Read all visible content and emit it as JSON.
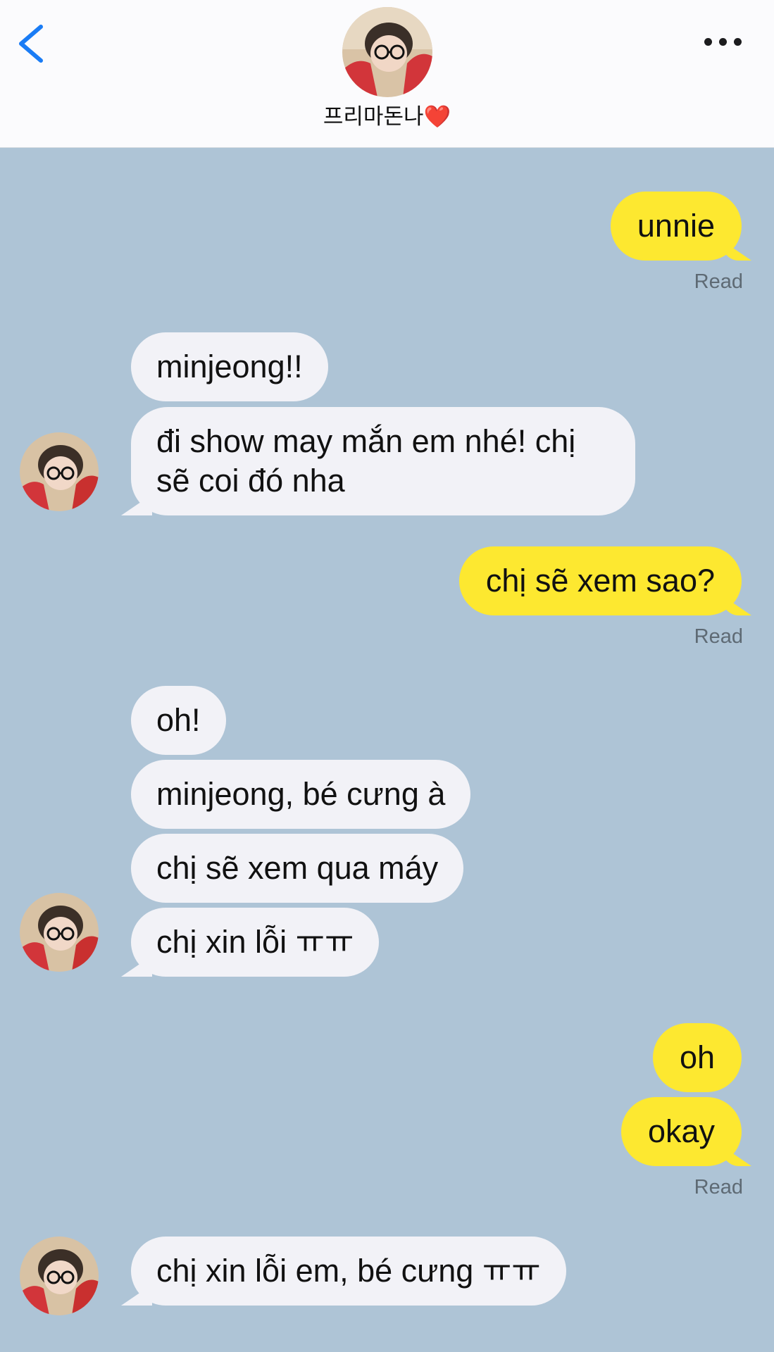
{
  "header": {
    "contact_name": "프리마돈나",
    "contact_emoji": "❤️"
  },
  "messages": {
    "m1": "unnie",
    "m2": "minjeong!!",
    "m3": "đi show may mắn em nhé! chị sẽ coi đó nha",
    "m4": "chị sẽ xem sao?",
    "m5": "oh!",
    "m6": "minjeong, bé cưng à",
    "m7": "chị sẽ xem qua máy",
    "m8": "chị xin lỗi ㅠㅠ",
    "m9": "oh",
    "m10": "okay",
    "m11": "chị xin lỗi em, bé cưng ㅠㅠ"
  },
  "status": {
    "read_label": "Read"
  },
  "colors": {
    "background": "#aec4d6",
    "outgoing_bubble": "#fde830",
    "incoming_bubble": "#f2f2f7",
    "accent_blue": "#1a7cf5"
  }
}
